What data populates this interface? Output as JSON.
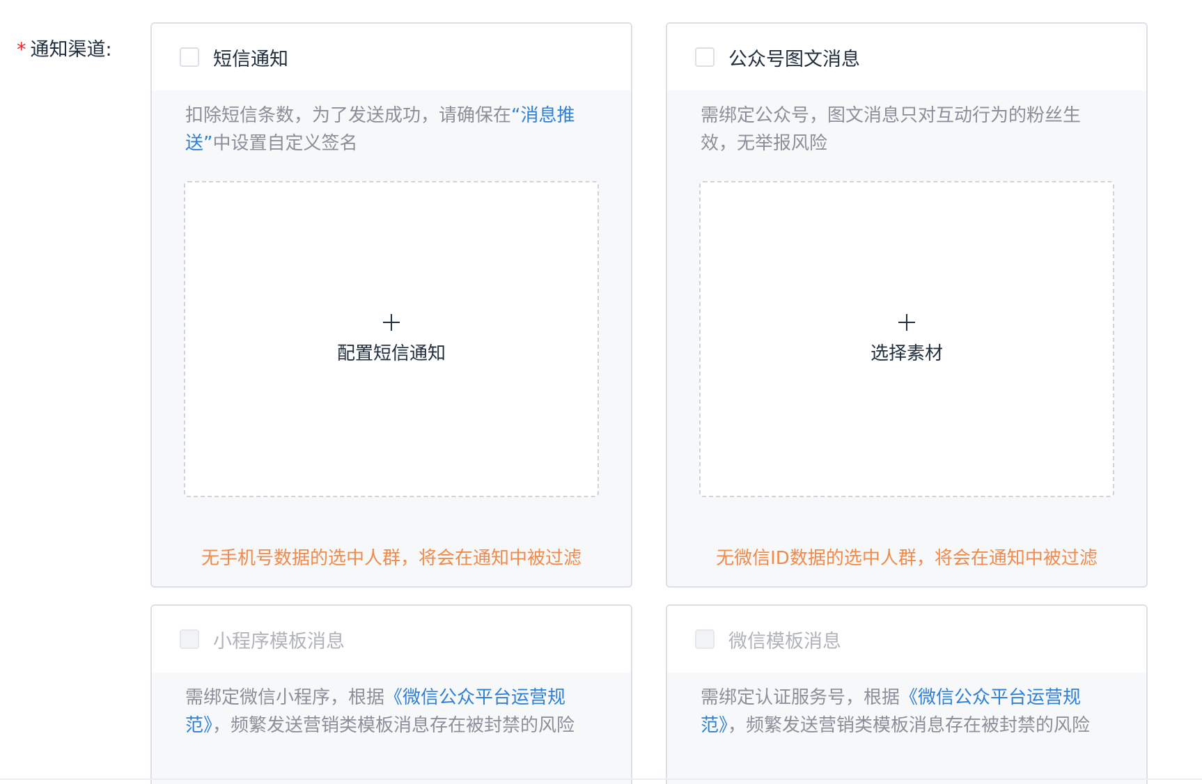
{
  "field": {
    "required_mark": "*",
    "label": "通知渠道:"
  },
  "channels": [
    {
      "title": "短信通知",
      "enabled": true,
      "desc_before": "扣除短信条数，为了发送成功，请确保在",
      "desc_link": "“消息推送”",
      "desc_after": "中设置自定义签名",
      "upload_label": "配置短信通知",
      "warning": "无手机号数据的选中人群，将会在通知中被过滤"
    },
    {
      "title": "公众号图文消息",
      "enabled": true,
      "desc_before": "需绑定公众号，图文消息只对互动行为的粉丝生效，无举报风险",
      "desc_link": "",
      "desc_after": "",
      "upload_label": "选择素材",
      "warning": "无微信ID数据的选中人群，将会在通知中被过滤"
    },
    {
      "title": "小程序模板消息",
      "enabled": false,
      "desc_before": "需绑定微信小程序，根据",
      "desc_link": "《微信公众平台运营规范》",
      "desc_after": "，频繁发送营销类模板消息存在被封禁的风险"
    },
    {
      "title": "微信模板消息",
      "enabled": false,
      "desc_before": "需绑定认证服务号，根据",
      "desc_link": "《微信公众平台运营规范》",
      "desc_after": "，频繁发送营销类模板消息存在被封禁的风险"
    }
  ],
  "colors": {
    "link": "#2f7fd6",
    "warning": "#f08a4b",
    "required": "#f5222d",
    "disabled_text": "#b0b3b9"
  }
}
